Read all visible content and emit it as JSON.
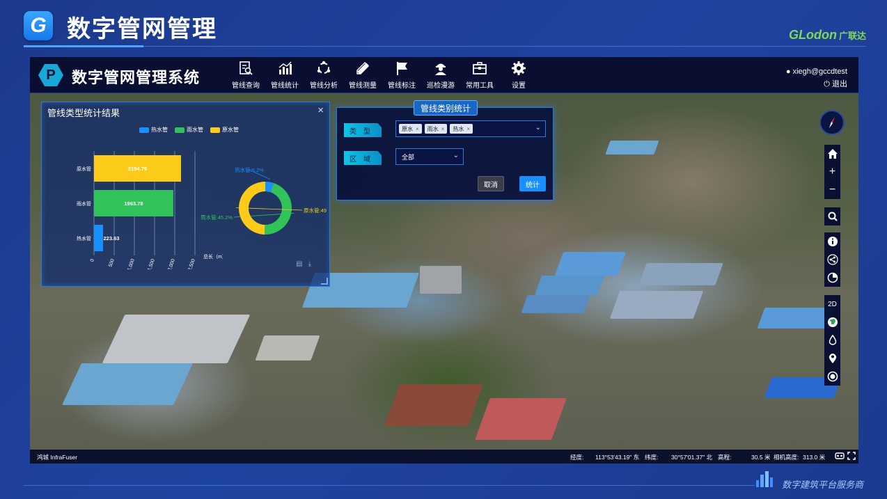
{
  "slide": {
    "title": "数字管网管理",
    "logo_letter": "G",
    "brand_en": "GLodon",
    "brand_cn": "广联达",
    "footer_text": "数字建筑平台服务商"
  },
  "app": {
    "system_title": "数字管网管理系统",
    "nav": [
      {
        "label": "管线查询",
        "icon": "search-document-icon"
      },
      {
        "label": "管线统计",
        "icon": "bar-chart-icon"
      },
      {
        "label": "管线分析",
        "icon": "cycle-icon"
      },
      {
        "label": "管线测量",
        "icon": "ruler-pencil-icon"
      },
      {
        "label": "管线标注",
        "icon": "flag-icon"
      },
      {
        "label": "巡检漫游",
        "icon": "inspector-icon"
      },
      {
        "label": "常用工具",
        "icon": "toolbox-icon"
      },
      {
        "label": "设置",
        "icon": "gear-icon"
      }
    ],
    "user": {
      "name": "xiegh@gccdtest",
      "logout": "退出"
    }
  },
  "stats_panel": {
    "title": "管线类型统计结果",
    "close": "×"
  },
  "chart_data": [
    {
      "type": "bar",
      "orientation": "horizontal",
      "categories": [
        "原水管",
        "雨水管",
        "热水管"
      ],
      "values": [
        2154.79,
        1963.78,
        223.63
      ],
      "colors": [
        "#fcca18",
        "#31c35a",
        "#1890ff"
      ],
      "value_labels": [
        "2154.79",
        "1963.78",
        "223.63"
      ],
      "xticks": [
        "0",
        "500",
        "1,000",
        "1,500",
        "2,000",
        "2,500"
      ],
      "xlim": [
        0,
        2500
      ],
      "xlabel": "总长（m）",
      "legend": [
        "热水管",
        "雨水管",
        "原水管"
      ],
      "legend_position": "top"
    },
    {
      "type": "pie",
      "donut": true,
      "labels": [
        "热水管",
        "雨水管",
        "原水管"
      ],
      "values": [
        5.2,
        45.2,
        49.6
      ],
      "colors": [
        "#1890ff",
        "#31c35a",
        "#fcca18"
      ],
      "slice_labels": [
        "热水管:5.2%",
        "雨水管:45.2%",
        "原水管:49"
      ]
    }
  ],
  "type_dialog": {
    "title": "管线类别统计",
    "type_label": "类型",
    "region_label": "区域",
    "tags": [
      "原水",
      "雨水",
      "热水"
    ],
    "region_value": "全部",
    "cancel": "取消",
    "ok": "统计"
  },
  "status": {
    "brand": "鸿城 InfraFuser",
    "lon_label": "经度:",
    "lon_value": "113°53'43.19\" 东",
    "lat_label": "纬度:",
    "lat_value": "30°57'01.37\" 北",
    "alt_label": "高程:",
    "alt_value": "30.5 米",
    "cam_label": "相机高度:",
    "cam_value": "313.0 米"
  },
  "right_tools": {
    "mode_2d": "2D"
  }
}
